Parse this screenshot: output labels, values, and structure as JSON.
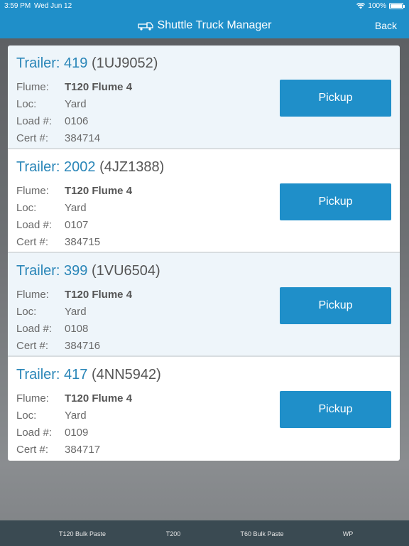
{
  "status_bar": {
    "time": "3:59 PM",
    "date": "Wed Jun 12",
    "battery": "100%"
  },
  "nav": {
    "title": "Shuttle Truck Manager",
    "back_label": "Back",
    "icon": "truck-icon"
  },
  "labels": {
    "trailer": "Trailer:",
    "flume": "Flume:",
    "loc": "Loc:",
    "load": "Load #:",
    "cert": "Cert #:",
    "pickup": "Pickup"
  },
  "trailers": [
    {
      "number": "419",
      "plate": "(1UJ9052)",
      "flume": "T120 Flume 4",
      "loc": "Yard",
      "load": "0106",
      "cert": "384714"
    },
    {
      "number": "2002",
      "plate": "(4JZ1388)",
      "flume": "T120 Flume 4",
      "loc": "Yard",
      "load": "0107",
      "cert": "384715"
    },
    {
      "number": "399",
      "plate": "(1VU6504)",
      "flume": "T120 Flume 4",
      "loc": "Yard",
      "load": "0108",
      "cert": "384716"
    },
    {
      "number": "417",
      "plate": "(4NN5942)",
      "flume": "T120 Flume 4",
      "loc": "Yard",
      "load": "0109",
      "cert": "384717"
    }
  ],
  "tabs": [
    {
      "label": "T120 Bulk Paste"
    },
    {
      "label": "T200"
    },
    {
      "label": "T60 Bulk Paste"
    },
    {
      "label": "WP"
    }
  ],
  "colors": {
    "accent": "#1f8fc9",
    "trailer_text": "#2a86b8",
    "tab_bar": "#3a4a52"
  }
}
